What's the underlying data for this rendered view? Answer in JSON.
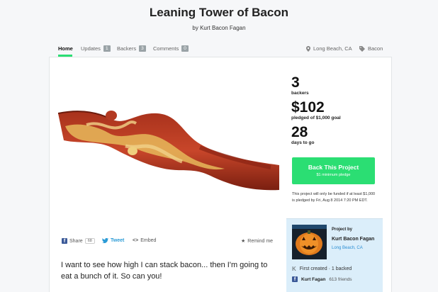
{
  "header": {
    "title": "Leaning Tower of Bacon",
    "byline": "by Kurt Bacon Fagan"
  },
  "nav": {
    "home": "Home",
    "updates": "Updates",
    "updates_count": "1",
    "backers": "Backers",
    "backers_count": "3",
    "comments": "Comments",
    "comments_count": "0",
    "location": "Long Beach, CA",
    "category": "Bacon"
  },
  "stats": {
    "backers_value": "3",
    "backers_label": "backers",
    "pledged_value": "$102",
    "pledged_label": "pledged of $1,000 goal",
    "days_value": "28",
    "days_label": "days to go"
  },
  "back_button": {
    "label": "Back This Project",
    "sub": "$1 minimum pledge"
  },
  "funding_note": "This project will only be funded if at least $1,000 is pledged by Fri, Aug 8 2014 7:20 PM EDT.",
  "share": {
    "share_label": "Share",
    "share_count": "68",
    "tweet_label": "Tweet",
    "embed_label": "Embed",
    "remind_label": "Remind me"
  },
  "blurb": "I want to see how high I can stack bacon... then I'm going to eat a bunch of it. So can you!",
  "creator": {
    "project_by": "Project by",
    "name": "Kurt Bacon Fagan",
    "location": "Long Beach, CA",
    "created_line": "First created · 1 backed",
    "fb_name": "Kurt Fagan",
    "fb_friends": "613 friends"
  },
  "colors": {
    "accent_green": "#2bde73",
    "facebook_blue": "#3b5998",
    "twitter_blue": "#2b9bd6",
    "creator_bg": "#dbeefa"
  }
}
